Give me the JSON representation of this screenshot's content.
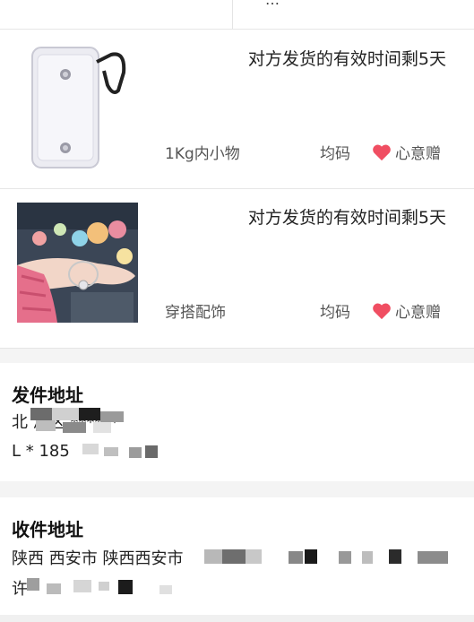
{
  "top": {
    "fragment": "…"
  },
  "items": [
    {
      "status": "对方发货的有效时间剩5天",
      "category": "1Kg内小物",
      "size": "均码",
      "gift_label": "心意赠",
      "image": "clear-pouch-with-carabiner"
    },
    {
      "status": "对方发货的有效时间剩5天",
      "category": "穿搭配饰",
      "size": "均码",
      "gift_label": "心意赠",
      "image": "bracelet-on-wrist-with-figures"
    }
  ],
  "sender": {
    "title": "发件地址",
    "line1": "北        湖区  ******",
    "line2": "L    * 185"
  },
  "receiver": {
    "title": "收件地址",
    "line1": "陕西 西安市 陕西西安市",
    "line2": "许"
  },
  "colors": {
    "heart": "#f04e62",
    "bg": "#f4f4f4"
  }
}
